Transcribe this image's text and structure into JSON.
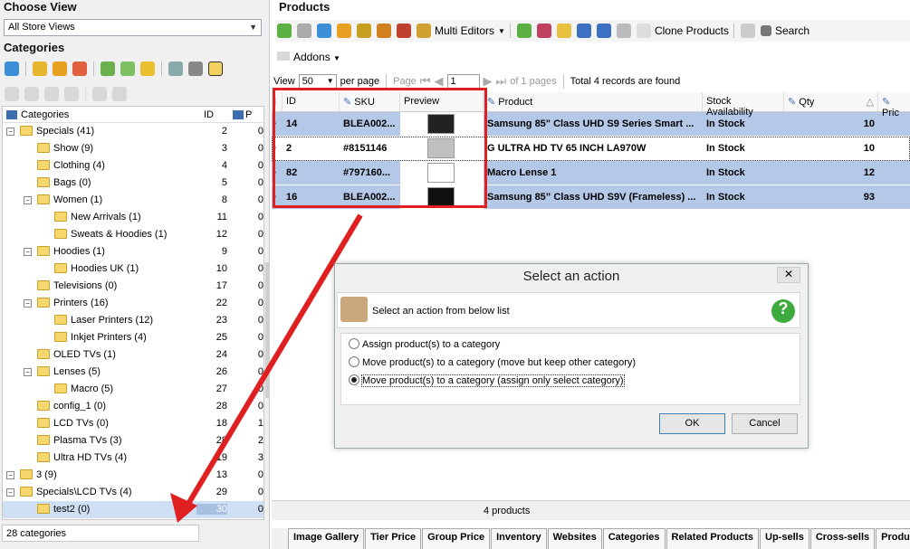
{
  "left": {
    "choose_view_title": "Choose View",
    "store_select": "All Store Views",
    "categories_title": "Categories",
    "tree_header": {
      "name": "Categories",
      "id": "ID",
      "p": "P"
    },
    "status": "28 categories",
    "rows": [
      {
        "label": "Specials (41)",
        "id": "2",
        "p": "0"
      },
      {
        "label": "Show (9)",
        "id": "3",
        "p": "0"
      },
      {
        "label": "Clothing (4)",
        "id": "4",
        "p": "0"
      },
      {
        "label": "Bags (0)",
        "id": "5",
        "p": "0"
      },
      {
        "label": "Women (1)",
        "id": "8",
        "p": "0"
      },
      {
        "label": "New Arrivals (1)",
        "id": "11",
        "p": "0"
      },
      {
        "label": "Sweats & Hoodies (1)",
        "id": "12",
        "p": "0"
      },
      {
        "label": "Hoodies (1)",
        "id": "9",
        "p": "0"
      },
      {
        "label": "Hoodies UK (1)",
        "id": "10",
        "p": "0"
      },
      {
        "label": "Televisions (0)",
        "id": "17",
        "p": "0"
      },
      {
        "label": "Printers (16)",
        "id": "22",
        "p": "0"
      },
      {
        "label": "Laser Printers (12)",
        "id": "23",
        "p": "0"
      },
      {
        "label": "Inkjet Printers (4)",
        "id": "25",
        "p": "0"
      },
      {
        "label": "OLED TVs (1)",
        "id": "24",
        "p": "0"
      },
      {
        "label": "Lenses (5)",
        "id": "26",
        "p": "0"
      },
      {
        "label": "Macro (5)",
        "id": "27",
        "p": "0"
      },
      {
        "label": "config_1 (0)",
        "id": "28",
        "p": "0"
      },
      {
        "label": "LCD TVs (0)",
        "id": "18",
        "p": "1"
      },
      {
        "label": "Plasma TVs (3)",
        "id": "28",
        "p": "2"
      },
      {
        "label": "Ultra HD TVs (4)",
        "id": "19",
        "p": "3"
      },
      {
        "label": "3 (9)",
        "id": "13",
        "p": "0"
      },
      {
        "label": "Specials\\LCD TVs (4)",
        "id": "29",
        "p": "0"
      },
      {
        "label": "test2 (0)",
        "id": "30",
        "p": "0"
      }
    ]
  },
  "right": {
    "title": "Products",
    "toolbar": {
      "multi_editors": "Multi Editors",
      "clone": "Clone Products",
      "search": "Search",
      "addons": "Addons"
    },
    "pager": {
      "view": "View",
      "per_page_value": "50",
      "per_page": "per page",
      "page": "Page",
      "page_value": "1",
      "of_pages": "of 1 pages",
      "total": "Total 4 records are found"
    },
    "columns": {
      "id": "ID",
      "sku": "SKU",
      "preview": "Preview",
      "product": "Product",
      "stock": "Stock Availability",
      "qty": "Qty",
      "price": "Pric"
    },
    "rows": [
      {
        "id": "14",
        "sku": "BLEA002...",
        "product": "Samsung 85\" Class UHD S9 Series Smart ...",
        "stock": "In Stock",
        "qty": "10"
      },
      {
        "id": "2",
        "sku": "#8151146",
        "product": "G ULTRA HD TV 65 INCH LA970W",
        "stock": "In Stock",
        "qty": "10"
      },
      {
        "id": "82",
        "sku": "#797160...",
        "product": "Macro Lense 1",
        "stock": "In Stock",
        "qty": "12"
      },
      {
        "id": "16",
        "sku": "BLEA002...",
        "product": "Samsung 85” Class UHD S9V (Frameless) ...",
        "stock": "In Stock",
        "qty": "93"
      }
    ],
    "footer": "4 products",
    "tabs": [
      "Image Gallery",
      "Tier Price",
      "Group Price",
      "Inventory",
      "Websites",
      "Categories",
      "Related Products",
      "Up-sells",
      "Cross-sells",
      "Produ"
    ]
  },
  "dialog": {
    "title": "Select an action",
    "prompt": "Select an action from below list",
    "options": [
      "Assign product(s) to a category",
      "Move product(s) to a category (move but keep other category)",
      "Move product(s) to a category (assign only select category)"
    ],
    "selected_index": 2,
    "ok": "OK",
    "cancel": "Cancel"
  },
  "colors": {
    "highlight": "#b4c8e8",
    "annotation_red": "#e02020",
    "folder": "#f5d76e"
  }
}
